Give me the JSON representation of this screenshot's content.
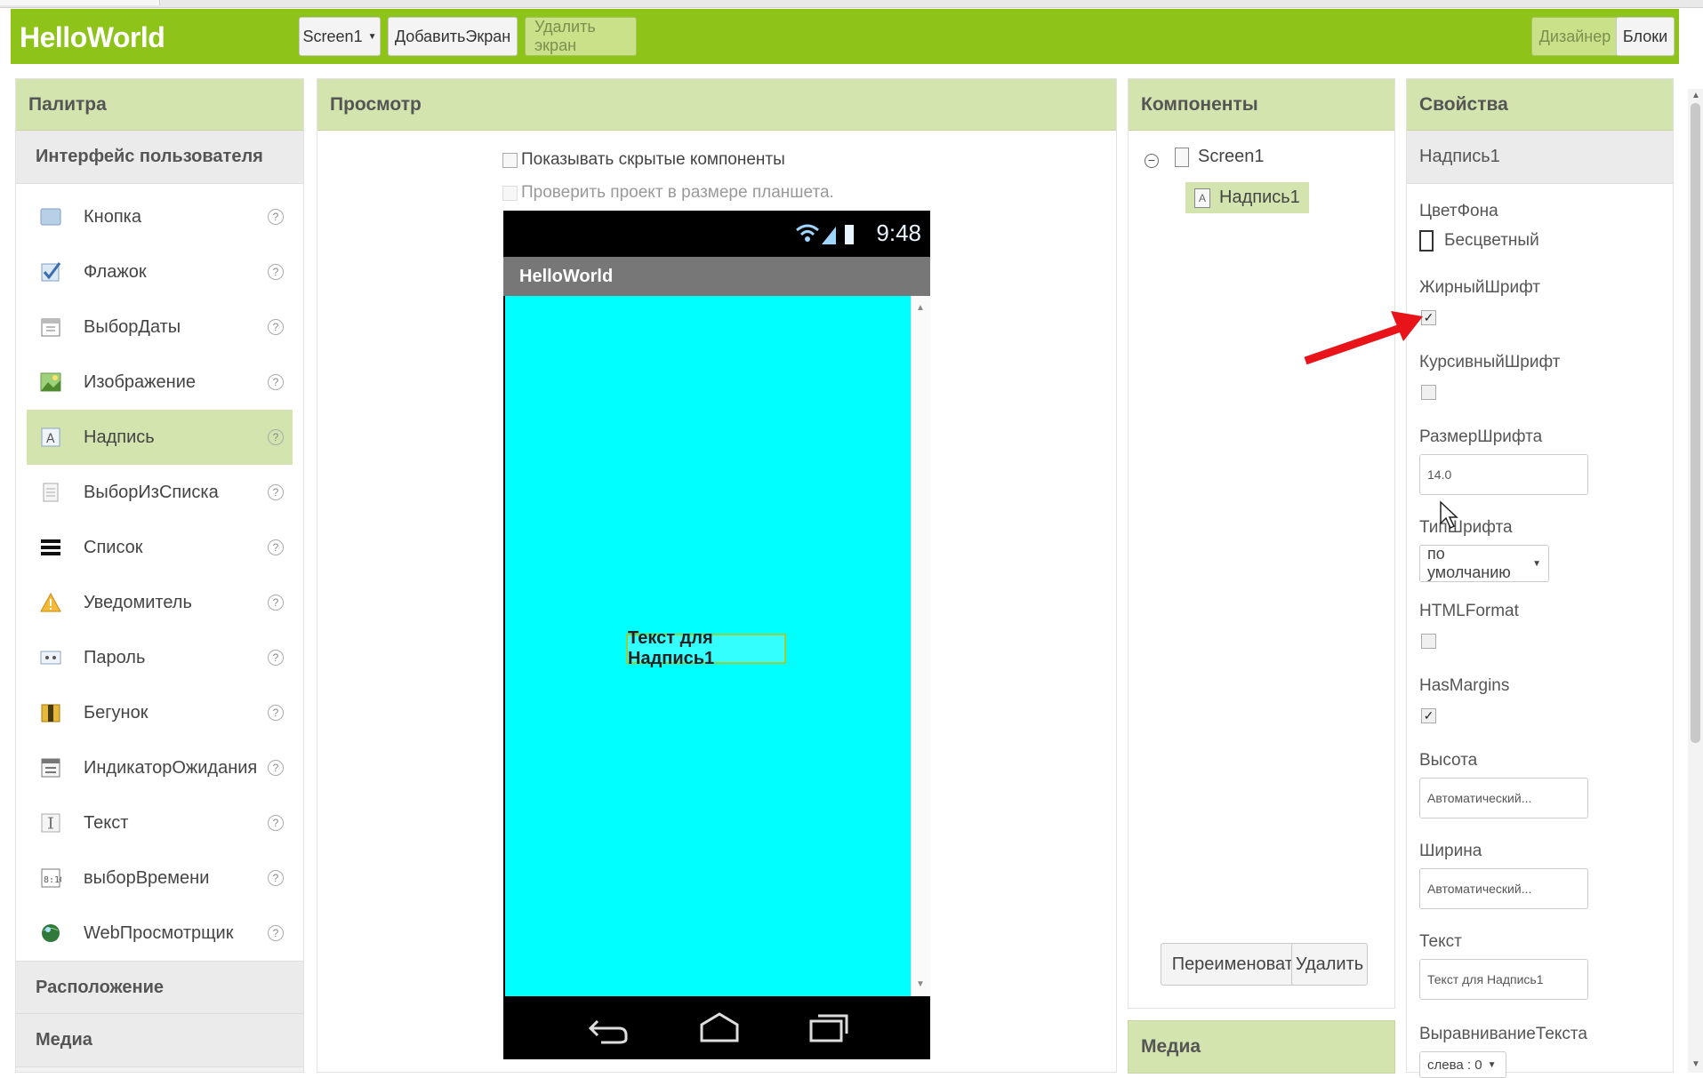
{
  "app": {
    "brand": "HelloWorld",
    "screen_select": "Screen1",
    "add_screen": "ДобавитьЭкран",
    "remove_screen": "Удалить экран",
    "designer": "Дизайнер",
    "blocks": "Блоки"
  },
  "palette": {
    "title": "Палитра",
    "section_ui": "Интерфейс пользователя",
    "items": [
      {
        "label": "Кнопка",
        "icon": "button-icon"
      },
      {
        "label": "Флажок",
        "icon": "checkbox-icon"
      },
      {
        "label": "ВыборДаты",
        "icon": "calendar-icon"
      },
      {
        "label": "Изображение",
        "icon": "image-icon"
      },
      {
        "label": "Надпись",
        "icon": "label-icon"
      },
      {
        "label": "ВыборИзСписка",
        "icon": "listpicker-icon"
      },
      {
        "label": "Список",
        "icon": "listview-icon"
      },
      {
        "label": "Уведомитель",
        "icon": "warning-icon"
      },
      {
        "label": "Пароль",
        "icon": "password-icon"
      },
      {
        "label": "Бегунок",
        "icon": "slider-icon"
      },
      {
        "label": "ИндикаторОжидания",
        "icon": "spinner-icon"
      },
      {
        "label": "Текст",
        "icon": "textbox-icon"
      },
      {
        "label": "выборВремени",
        "icon": "clock-icon"
      },
      {
        "label": "WebПросмотрщик",
        "icon": "globe-icon"
      }
    ],
    "help_glyph": "?",
    "section_layout": "Расположение",
    "section_media": "Медиа"
  },
  "viewer": {
    "title": "Просмотр",
    "show_hidden": "Показывать скрытые компоненты",
    "tablet_size": "Проверить проект в размере планшета.",
    "phone_time": "9:48",
    "phone_title": "HelloWorld",
    "label_text": "Текст для Надпись1",
    "screen_color": "#00ffff"
  },
  "components": {
    "title": "Компоненты",
    "root": "Screen1",
    "child": "Надпись1",
    "rename": "Переименовать",
    "delete": "Удалить",
    "media_title": "Медиа"
  },
  "properties": {
    "title": "Свойства",
    "component": "Надпись1",
    "bg_label": "ЦветФона",
    "bg_value": "Бесцветный",
    "bold_label": "ЖирныйШрифт",
    "italic_label": "КурсивныйШрифт",
    "fontsize_label": "РазмерШрифта",
    "fontsize_value": "14.0",
    "typeface_label": "ТипШрифта",
    "typeface_value": "по умолчанию",
    "html_label": "HTMLFormat",
    "margins_label": "HasMargins",
    "height_label": "Высота",
    "height_value": "Автоматический...",
    "width_label": "Ширина",
    "width_value": "Автоматический...",
    "text_label": "Текст",
    "text_value": "Текст для Надпись1",
    "align_label": "ВыравниваниеТекста",
    "align_value": "слева : 0",
    "bold_checked": true,
    "italic_checked": false,
    "html_checked": false,
    "margins_checked": true
  },
  "colors": {
    "brand_green": "#8ec31a",
    "panel_header": "#d3e4ae",
    "annotation_arrow": "#e8141a"
  }
}
